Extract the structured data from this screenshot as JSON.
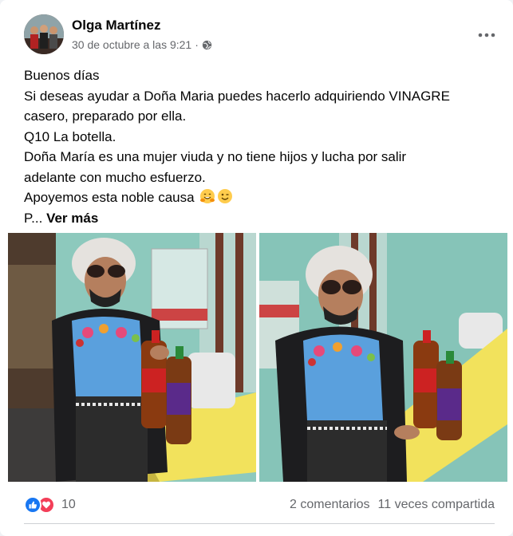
{
  "post": {
    "author": "Olga Martínez",
    "timestamp": "30 de octubre a las 9:21",
    "separator": "·",
    "audience_icon": "globe-icon",
    "lines": [
      "Buenos días",
      "Si deseas ayudar a Doña Maria puedes hacerlo adquiriendo VINAGRE",
      "casero, preparado por ella.",
      "Q10 La botella.",
      "Doña María es una mujer viuda y no tiene hijos y lucha por salir",
      "adelante con mucho esfuerzo.",
      "Apoyemos esta noble causa"
    ],
    "truncated_prefix": "P...",
    "see_more": "Ver más",
    "emojis": [
      "hugging-face-icon",
      "winking-face-icon"
    ]
  },
  "footer": {
    "reaction_count": "10",
    "comments": "2 comentarios",
    "shares": "11 veces compartida"
  },
  "colors": {
    "link_blue": "#1877f2",
    "love_red": "#f33e58",
    "secondary_text": "#65676b"
  }
}
